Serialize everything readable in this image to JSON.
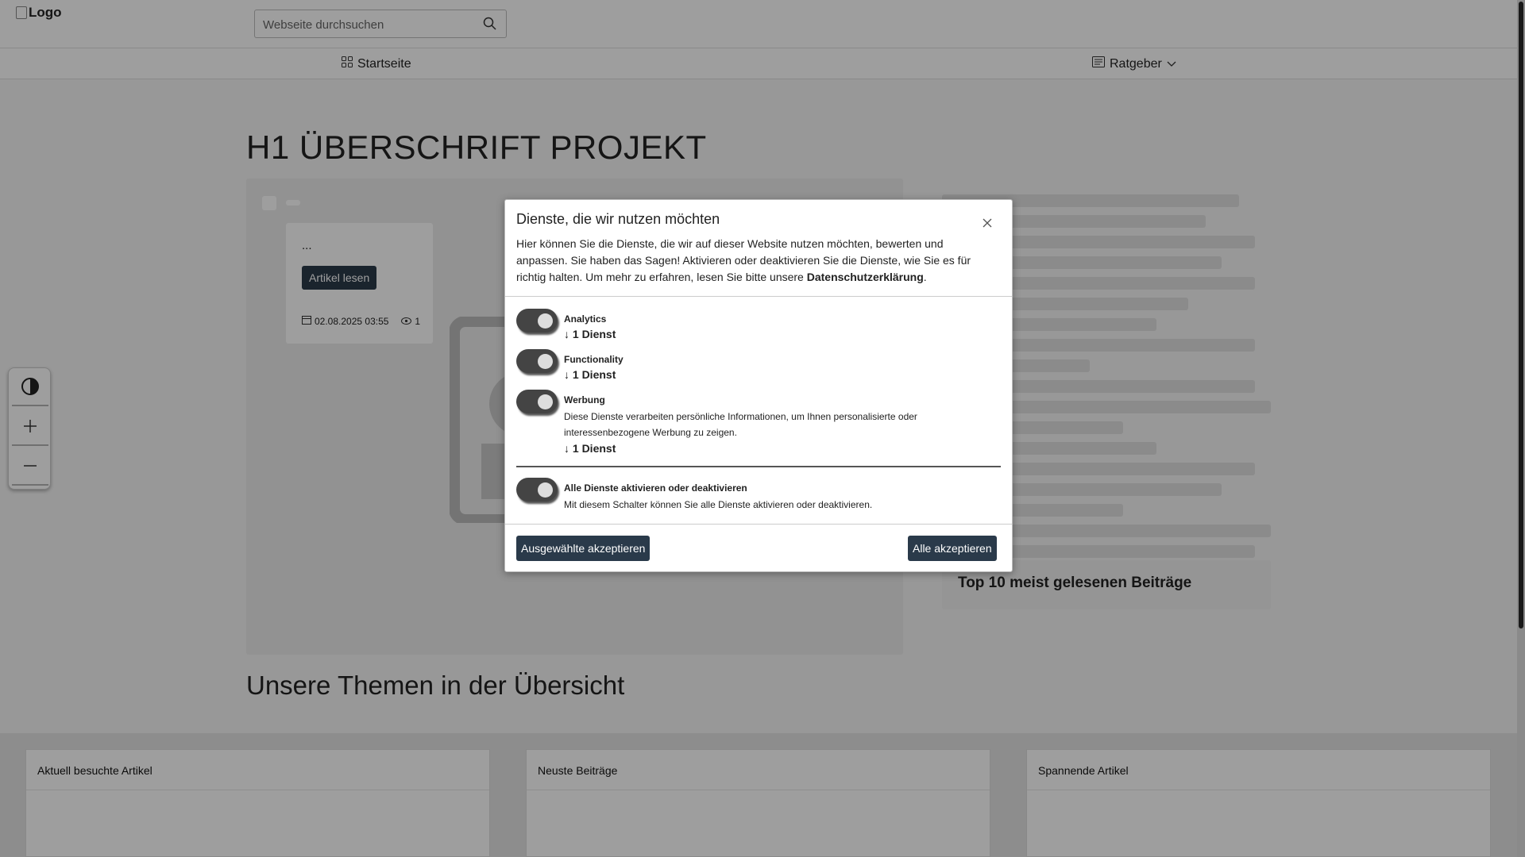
{
  "header": {
    "logo_alt": "Logo",
    "search_placeholder": "Webseite durchsuchen"
  },
  "nav": {
    "items": [
      {
        "label": "Startseite",
        "icon": "grid-icon"
      },
      {
        "label": "Ratgeber",
        "icon": "newspaper-icon"
      }
    ]
  },
  "main": {
    "title": "H1 ÜBERSCHRIFT PROJEKT",
    "card": {
      "excerpt": "...",
      "button": "Artikel lesen",
      "date": "02.08.2025 03:55",
      "views": "1"
    },
    "sidebar_title": "Top 10 meist gelesenen Beiträge",
    "section_title": "Unsere Themen in der Übersicht"
  },
  "bottom_panels": [
    {
      "title": "Aktuell besuchte Artikel"
    },
    {
      "title": "Neuste Beiträge"
    },
    {
      "title": "Spannende Artikel"
    }
  ],
  "accessibility": [
    "contrast-icon",
    "zoom-in-icon",
    "zoom-out-icon"
  ],
  "consent": {
    "title": "Dienste, die wir nutzen möchten",
    "intro": "Hier können Sie die Dienste, die wir auf dieser Website nutzen möchten, bewerten und anpassen. Sie haben das Sagen! Aktivieren oder deaktivieren Sie die Dienste, wie Sie es für richtig halten. Um mehr zu erfahren, lesen Sie bitte unsere ",
    "privacy_link": "Datenschutzerklärung",
    "intro_end": ".",
    "services": [
      {
        "name": "Analytics",
        "count": "↓ 1 Dienst",
        "enabled": true
      },
      {
        "name": "Functionality",
        "count": "↓ 1 Dienst",
        "enabled": true
      },
      {
        "name": "Werbung",
        "description": "Diese Dienste verarbeiten persönliche Informationen, um Ihnen personalisierte oder interessenbezogene Werbung zu zeigen.",
        "count": "↓ 1 Dienst",
        "enabled": true
      }
    ],
    "toggle_all": {
      "name": "Alle Dienste aktivieren oder deaktivieren",
      "description": "Mit diesem Schalter können Sie alle Dienste aktivieren oder deaktivieren.",
      "enabled": true
    },
    "accept_selected": "Ausgewählte akzeptieren",
    "accept_all": "Alle akzeptieren"
  },
  "colors": {
    "button": "#2a3a4a",
    "toggle": "#444444",
    "overlay": "rgba(0,0,0,0.38)"
  }
}
